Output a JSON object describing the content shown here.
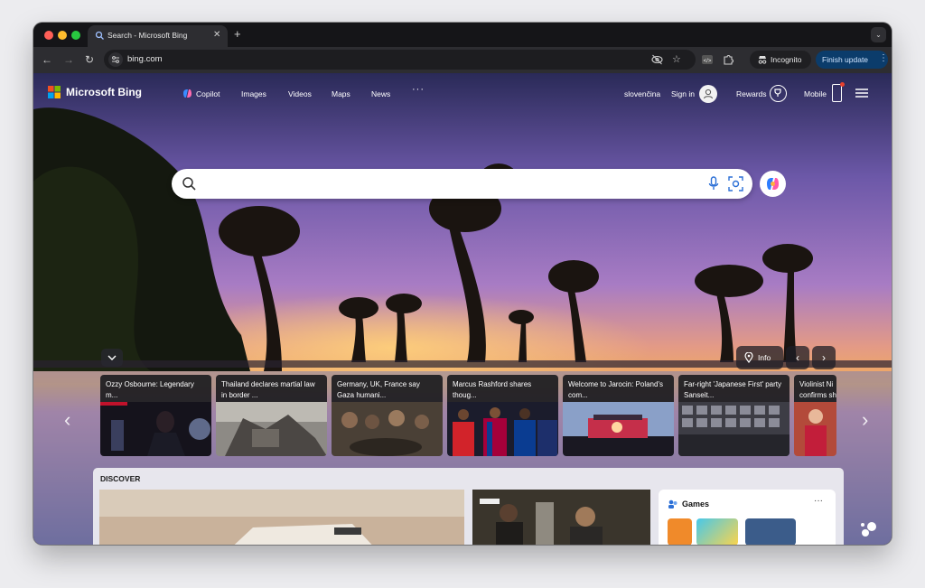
{
  "browser": {
    "tab_title": "Search - Microsoft Bing",
    "new_tab": "+",
    "url": "bing.com",
    "incognito_label": "Incognito",
    "finish_update_label": "Finish update"
  },
  "header": {
    "brand": "Microsoft Bing",
    "nav": [
      "Copilot",
      "Images",
      "Videos",
      "Maps",
      "News"
    ],
    "more": "···",
    "language": "slovenčina",
    "sign_in": "Sign in",
    "rewards": "Rewards",
    "mobile": "Mobile"
  },
  "search": {
    "value": "",
    "placeholder": ""
  },
  "hero": {
    "info_label": "Info"
  },
  "news": [
    {
      "title": "Ozzy Osbourne: Legendary m..."
    },
    {
      "title": "Thailand declares martial law in border ..."
    },
    {
      "title": "Germany, UK, France say Gaza humani..."
    },
    {
      "title": "Marcus Rashford shares thoug..."
    },
    {
      "title": "Welcome to Jarocin: Poland's com..."
    },
    {
      "title": "Far-right 'Japanese First' party Sanseit..."
    },
    {
      "title": "Violinist Ni confirms sh"
    }
  ],
  "discover": {
    "label": "DISCOVER",
    "games_title": "Games",
    "games_more": "···"
  },
  "colors": {
    "finish_update_bg": "#0b3c6b",
    "accent_blue": "#2b6fd6"
  }
}
